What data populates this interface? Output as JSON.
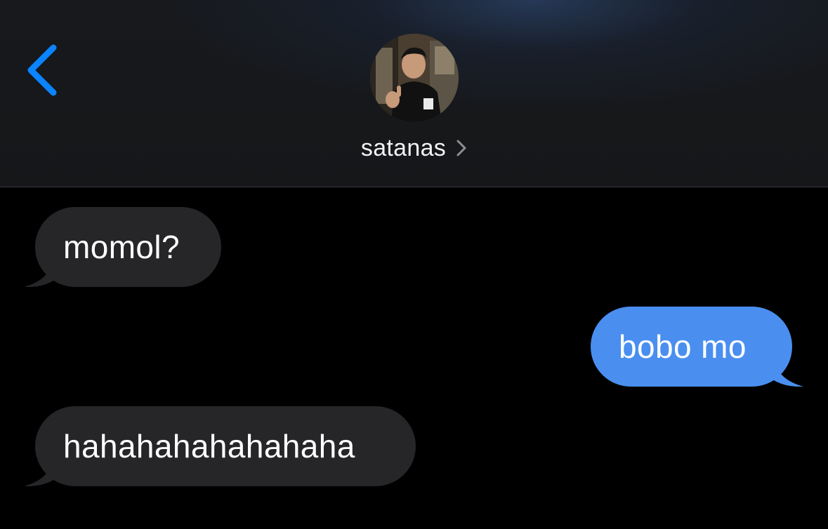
{
  "header": {
    "contact_name": "satanas",
    "back_icon": "chevron-left-icon",
    "name_chevron_icon": "chevron-right-icon",
    "accent_color": "#0a84ff"
  },
  "messages": [
    {
      "direction": "received",
      "text": "momol?"
    },
    {
      "direction": "sent",
      "text": "bobo mo"
    },
    {
      "direction": "received",
      "text": "hahahahahahahaha"
    }
  ],
  "colors": {
    "received_bubble": "#262629",
    "sent_bubble": "#4a8ff0",
    "background": "#000000"
  }
}
